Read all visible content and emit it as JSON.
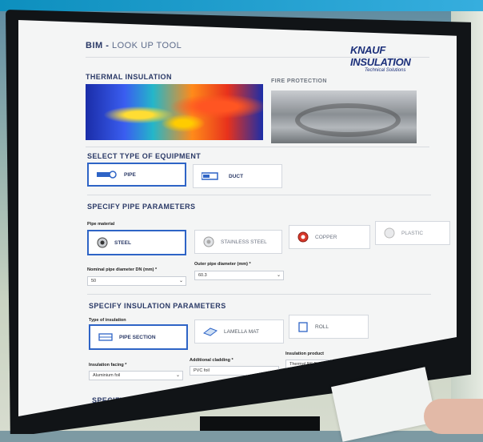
{
  "header": {
    "title_main": "BIM",
    "title_sep": " - ",
    "title_sub": "LOOK UP TOOL"
  },
  "logo": {
    "brand": "KNAUF INSULATION",
    "tagline": "Technical Solutions"
  },
  "application": {
    "thermal_label": "THERMAL INSULATION",
    "fire_label": "FIRE PROTECTION"
  },
  "equipment": {
    "heading": "SELECT TYPE OF EQUIPMENT",
    "options": [
      {
        "label": "PIPE",
        "selected": true
      },
      {
        "label": "DUCT",
        "selected": false
      }
    ]
  },
  "pipe": {
    "heading": "SPECIFY PIPE PARAMETERS",
    "material_label": "Pipe material",
    "materials": [
      {
        "label": "STEEL",
        "selected": true
      },
      {
        "label": "STAINLESS STEEL",
        "selected": false
      },
      {
        "label": "COPPER",
        "selected": false
      },
      {
        "label": "PLASTIC",
        "selected": false
      }
    ],
    "nominal_label": "Nominal pipe diameter DN (mm) *",
    "nominal_value": "50",
    "outer_label": "Outer pipe diameter (mm) *",
    "outer_value": "60.3"
  },
  "insulation": {
    "heading": "SPECIFY INSULATION PARAMETERS",
    "type_label": "Type of insulation",
    "types": [
      {
        "label": "PIPE SECTION",
        "selected": true
      },
      {
        "label": "LAMELLA MAT",
        "selected": false
      },
      {
        "label": "ROLL",
        "selected": false
      }
    ],
    "facing_label": "Insulation facing *",
    "facing_value": "Aluminium foil",
    "cladding_label": "Additional cladding *",
    "cladding_value": "PVC foil",
    "product_label": "Insulation product",
    "product_value": "Thermal PS Pro ALU"
  },
  "requirements": {
    "heading": "SPECIFY INSULATION REQUIREMENTS"
  },
  "colors": {
    "accent": "#2e64c6",
    "heading": "#2b3a67",
    "top_band": "#0d8fbe"
  }
}
